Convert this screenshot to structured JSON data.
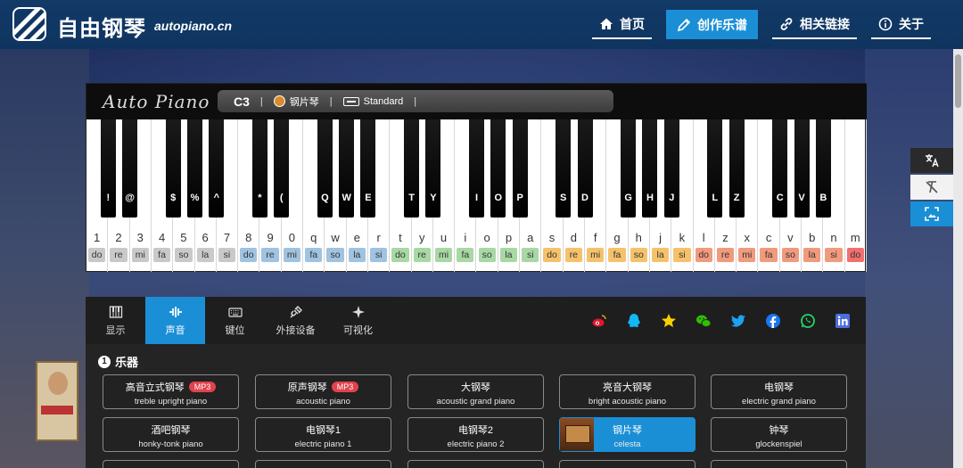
{
  "header": {
    "brand": "自由钢琴",
    "domain": "autopiano.cn",
    "nav": [
      {
        "label": "首页",
        "icon": "home-icon",
        "active": false
      },
      {
        "label": "创作乐谱",
        "icon": "pen-icon",
        "active": true
      },
      {
        "label": "相关链接",
        "icon": "link-icon",
        "active": false
      },
      {
        "label": "关于",
        "icon": "info-icon",
        "active": false
      }
    ]
  },
  "piano": {
    "logo_text": "Auto Piano",
    "note": "C3",
    "instrument": "钢片琴",
    "keyboard_mode": "Standard",
    "white_keys": [
      {
        "key": "1",
        "sol": "do",
        "color": "#c9c9c9"
      },
      {
        "key": "2",
        "sol": "re",
        "color": "#c9c9c9"
      },
      {
        "key": "3",
        "sol": "mi",
        "color": "#c9c9c9"
      },
      {
        "key": "4",
        "sol": "fa",
        "color": "#c9c9c9"
      },
      {
        "key": "5",
        "sol": "so",
        "color": "#c9c9c9"
      },
      {
        "key": "6",
        "sol": "la",
        "color": "#c9c9c9"
      },
      {
        "key": "7",
        "sol": "si",
        "color": "#c9c9c9"
      },
      {
        "key": "8",
        "sol": "do",
        "color": "#9fc3e0"
      },
      {
        "key": "9",
        "sol": "re",
        "color": "#9fc3e0"
      },
      {
        "key": "0",
        "sol": "mi",
        "color": "#9fc3e0"
      },
      {
        "key": "q",
        "sol": "fa",
        "color": "#9fc3e0"
      },
      {
        "key": "w",
        "sol": "so",
        "color": "#9fc3e0"
      },
      {
        "key": "e",
        "sol": "la",
        "color": "#9fc3e0"
      },
      {
        "key": "r",
        "sol": "si",
        "color": "#9fc3e0"
      },
      {
        "key": "t",
        "sol": "do",
        "color": "#a8d8a4"
      },
      {
        "key": "y",
        "sol": "re",
        "color": "#a8d8a4"
      },
      {
        "key": "u",
        "sol": "mi",
        "color": "#a8d8a4"
      },
      {
        "key": "i",
        "sol": "fa",
        "color": "#a8d8a4"
      },
      {
        "key": "o",
        "sol": "so",
        "color": "#a8d8a4"
      },
      {
        "key": "p",
        "sol": "la",
        "color": "#a8d8a4"
      },
      {
        "key": "a",
        "sol": "si",
        "color": "#a8d8a4"
      },
      {
        "key": "s",
        "sol": "do",
        "color": "#f5c26b"
      },
      {
        "key": "d",
        "sol": "re",
        "color": "#f5c26b"
      },
      {
        "key": "f",
        "sol": "mi",
        "color": "#f5c26b"
      },
      {
        "key": "g",
        "sol": "fa",
        "color": "#f5c26b"
      },
      {
        "key": "h",
        "sol": "so",
        "color": "#f5c26b"
      },
      {
        "key": "j",
        "sol": "la",
        "color": "#f5c26b"
      },
      {
        "key": "k",
        "sol": "si",
        "color": "#f5c26b"
      },
      {
        "key": "l",
        "sol": "do",
        "color": "#f09a7e"
      },
      {
        "key": "z",
        "sol": "re",
        "color": "#f09a7e"
      },
      {
        "key": "x",
        "sol": "mi",
        "color": "#f09a7e"
      },
      {
        "key": "c",
        "sol": "fa",
        "color": "#f09a7e"
      },
      {
        "key": "v",
        "sol": "so",
        "color": "#f09a7e"
      },
      {
        "key": "b",
        "sol": "la",
        "color": "#f09a7e"
      },
      {
        "key": "n",
        "sol": "si",
        "color": "#f09a7e"
      },
      {
        "key": "m",
        "sol": "do",
        "color": "#f07070"
      }
    ],
    "black_keys": [
      {
        "after": 0,
        "key": "!"
      },
      {
        "after": 1,
        "key": "@"
      },
      {
        "after": 3,
        "key": "$"
      },
      {
        "after": 4,
        "key": "%"
      },
      {
        "after": 5,
        "key": "^"
      },
      {
        "after": 7,
        "key": "*"
      },
      {
        "after": 8,
        "key": "("
      },
      {
        "after": 10,
        "key": "Q"
      },
      {
        "after": 11,
        "key": "W"
      },
      {
        "after": 12,
        "key": "E"
      },
      {
        "after": 14,
        "key": "T"
      },
      {
        "after": 15,
        "key": "Y"
      },
      {
        "after": 17,
        "key": "I"
      },
      {
        "after": 18,
        "key": "O"
      },
      {
        "after": 19,
        "key": "P"
      },
      {
        "after": 21,
        "key": "S"
      },
      {
        "after": 22,
        "key": "D"
      },
      {
        "after": 24,
        "key": "G"
      },
      {
        "after": 25,
        "key": "H"
      },
      {
        "after": 26,
        "key": "J"
      },
      {
        "after": 28,
        "key": "L"
      },
      {
        "after": 29,
        "key": "Z"
      },
      {
        "after": 31,
        "key": "C"
      },
      {
        "after": 32,
        "key": "V"
      },
      {
        "after": 33,
        "key": "B"
      }
    ]
  },
  "tabs": [
    {
      "label": "显示",
      "icon": "piano-icon",
      "active": false
    },
    {
      "label": "声音",
      "icon": "sound-wave-icon",
      "active": true
    },
    {
      "label": "键位",
      "icon": "keyboard-icon",
      "active": false
    },
    {
      "label": "外接设备",
      "icon": "plug-icon",
      "active": false
    },
    {
      "label": "可视化",
      "icon": "sparkle-icon",
      "active": false
    }
  ],
  "share": [
    {
      "name": "weibo-icon",
      "color": "#e6162d"
    },
    {
      "name": "qq-icon",
      "color": "#12b7f5"
    },
    {
      "name": "qzone-icon",
      "color": "#fece00"
    },
    {
      "name": "wechat-icon",
      "color": "#2dc100"
    },
    {
      "name": "twitter-icon",
      "color": "#1da1f2"
    },
    {
      "name": "facebook-icon",
      "color": "#1877f2"
    },
    {
      "name": "whatsapp-icon",
      "color": "#25d366"
    },
    {
      "name": "linkedin-icon",
      "color": "#4a6ee0"
    }
  ],
  "section": {
    "number": "1",
    "title": "乐器"
  },
  "instruments": [
    {
      "cn": "高音立式钢琴",
      "en": "treble upright piano",
      "mp3": "MP3",
      "selected": false
    },
    {
      "cn": "原声钢琴",
      "en": "acoustic piano",
      "mp3": "MP3",
      "selected": false
    },
    {
      "cn": "大钢琴",
      "en": "acoustic grand piano",
      "selected": false
    },
    {
      "cn": "亮音大钢琴",
      "en": "bright acoustic piano",
      "selected": false
    },
    {
      "cn": "电钢琴",
      "en": "electric grand piano",
      "selected": false
    },
    {
      "cn": "酒吧钢琴",
      "en": "honky-tonk piano",
      "selected": false
    },
    {
      "cn": "电钢琴1",
      "en": "electric piano 1",
      "selected": false
    },
    {
      "cn": "电钢琴2",
      "en": "electric piano 2",
      "selected": false
    },
    {
      "cn": "钢片琴",
      "en": "celesta",
      "selected": true
    },
    {
      "cn": "钟琴",
      "en": "glockenspiel",
      "selected": false
    }
  ],
  "colors": {
    "accent": "#1a8fd6",
    "header": "#0f3460",
    "mp3_badge": "#e2424c"
  }
}
